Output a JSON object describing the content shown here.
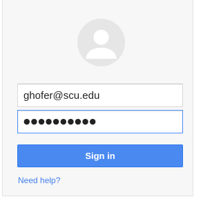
{
  "signin_form": {
    "avatar_icon": "default-user-avatar-icon",
    "email_value": "ghofer@scu.edu",
    "password_value": "●●●●●●●●●●",
    "signin_label": "Sign in",
    "help_label": "Need help?"
  },
  "colors": {
    "card_background": "#f7f7f7",
    "button_blue": "#4a89f0",
    "focus_border": "#4d90fe",
    "link_blue": "#427fed"
  }
}
